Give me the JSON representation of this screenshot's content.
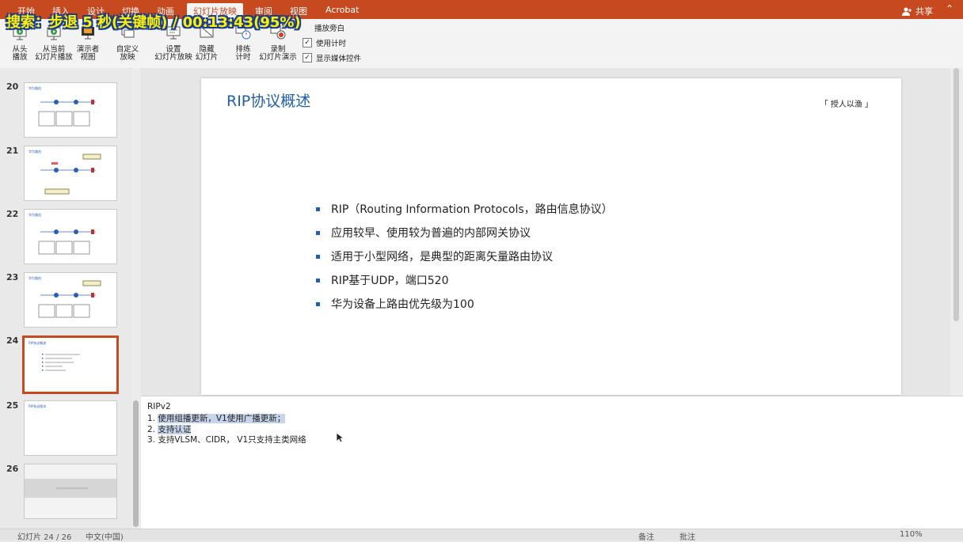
{
  "overlay": {
    "text": "搜索：步退 5 秒(关键帧) / 00:13:43(95%)"
  },
  "tabs": [
    {
      "label": "开始"
    },
    {
      "label": "插入"
    },
    {
      "label": "设计"
    },
    {
      "label": "切换"
    },
    {
      "label": "动画"
    },
    {
      "label": "幻灯片放映"
    },
    {
      "label": "审阅"
    },
    {
      "label": "视图"
    },
    {
      "label": "Acrobat"
    }
  ],
  "share": {
    "label": "共享"
  },
  "ribbon": {
    "from_start": "从头\n播放",
    "from_current": "从当前\n幻灯片播放",
    "presenter_view": "演示者\n视图",
    "custom_show": "自定义\n放映",
    "setup_show": "设置\n幻灯片放映",
    "hide_slide": "隐藏\n幻灯片",
    "rehearse": "排练\n计时",
    "record": "录制\n幻灯片演示",
    "play_narration": "播放旁白",
    "use_timings": "使用计时",
    "show_media_controls": "显示媒体控件"
  },
  "thumbnails": [
    {
      "num": "20",
      "title": "华为路由"
    },
    {
      "num": "21",
      "title": "华为路由"
    },
    {
      "num": "22",
      "title": "华为路由"
    },
    {
      "num": "23",
      "title": "华为路由"
    },
    {
      "num": "24",
      "title": "RIP协议概述"
    },
    {
      "num": "25",
      "title": "RIP协议版本"
    },
    {
      "num": "26",
      "title": ""
    }
  ],
  "slide": {
    "title": "RIP协议概述",
    "tag": "「 授人以渔 」",
    "bullets": [
      "RIP（Routing Information Protocols，路由信息协议）",
      "应用较早、使用较为普遍的内部网关协议",
      "适用于小型网络，是典型的距离矢量路由协议",
      "RIP基于UDP，端口520",
      "华为设备上路由优先级为100"
    ]
  },
  "notes": {
    "heading": "RIPv2",
    "lines": [
      {
        "num": "1.",
        "text": "使用组播更新，V1使用广播更新；"
      },
      {
        "num": "2.",
        "text": "支持认证"
      },
      {
        "num": "3.",
        "text": "支持VLSM、CIDR，  V1只支持主类网络"
      }
    ]
  },
  "status": {
    "slide_info": "幻灯片 24 / 26",
    "language": "中文(中国)",
    "notes_btn": "备注",
    "comments_btn": "批注",
    "zoom": "110%"
  },
  "colors": {
    "accent": "#c6491f",
    "title_blue": "#1f5ea8"
  }
}
